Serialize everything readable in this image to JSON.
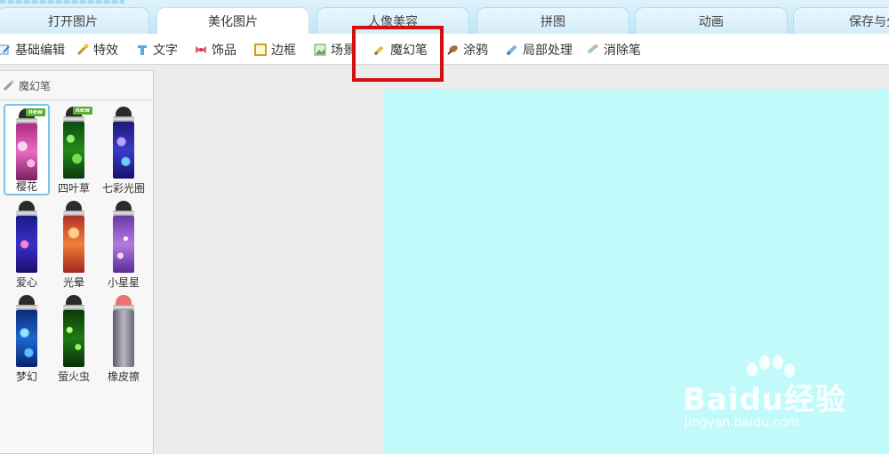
{
  "tabs": [
    "打开图片",
    "美化图片",
    "人像美容",
    "拼图",
    "动画",
    "保存与分"
  ],
  "active_tab": "美化图片",
  "toolbar": {
    "items": [
      {
        "label": "基础编辑",
        "icon": "edit-icon"
      },
      {
        "label": "特效",
        "icon": "magic-wand-icon"
      },
      {
        "label": "文字",
        "icon": "text-icon"
      },
      {
        "label": "饰品",
        "icon": "bow-icon"
      },
      {
        "label": "边框",
        "icon": "frame-icon"
      },
      {
        "label": "场景",
        "icon": "scene-icon"
      },
      {
        "label": "魔幻笔",
        "icon": "magic-pen-icon"
      },
      {
        "label": "涂鸦",
        "icon": "doodle-icon"
      },
      {
        "label": "局部处理",
        "icon": "local-edit-icon"
      },
      {
        "label": "消除笔",
        "icon": "eraser-pen-icon"
      }
    ]
  },
  "panel": {
    "title": "魔幻笔",
    "brushes": [
      {
        "label": "樱花",
        "new": "new",
        "selected": true
      },
      {
        "label": "四叶草",
        "new": "new",
        "selected": false
      },
      {
        "label": "七彩光圈",
        "selected": false
      },
      {
        "label": "爱心",
        "selected": false
      },
      {
        "label": "光晕",
        "selected": false
      },
      {
        "label": "小星星",
        "selected": false
      },
      {
        "label": "梦幻",
        "selected": false
      },
      {
        "label": "萤火虫",
        "selected": false
      },
      {
        "label": "橡皮擦",
        "selected": false
      }
    ]
  },
  "watermark": {
    "text": "Baidu经验",
    "url": "jingyan.baidu.com"
  },
  "colors": {
    "canvas": "#c2fafc",
    "highlight": "#d41010",
    "selection": "#7bc3e6"
  }
}
